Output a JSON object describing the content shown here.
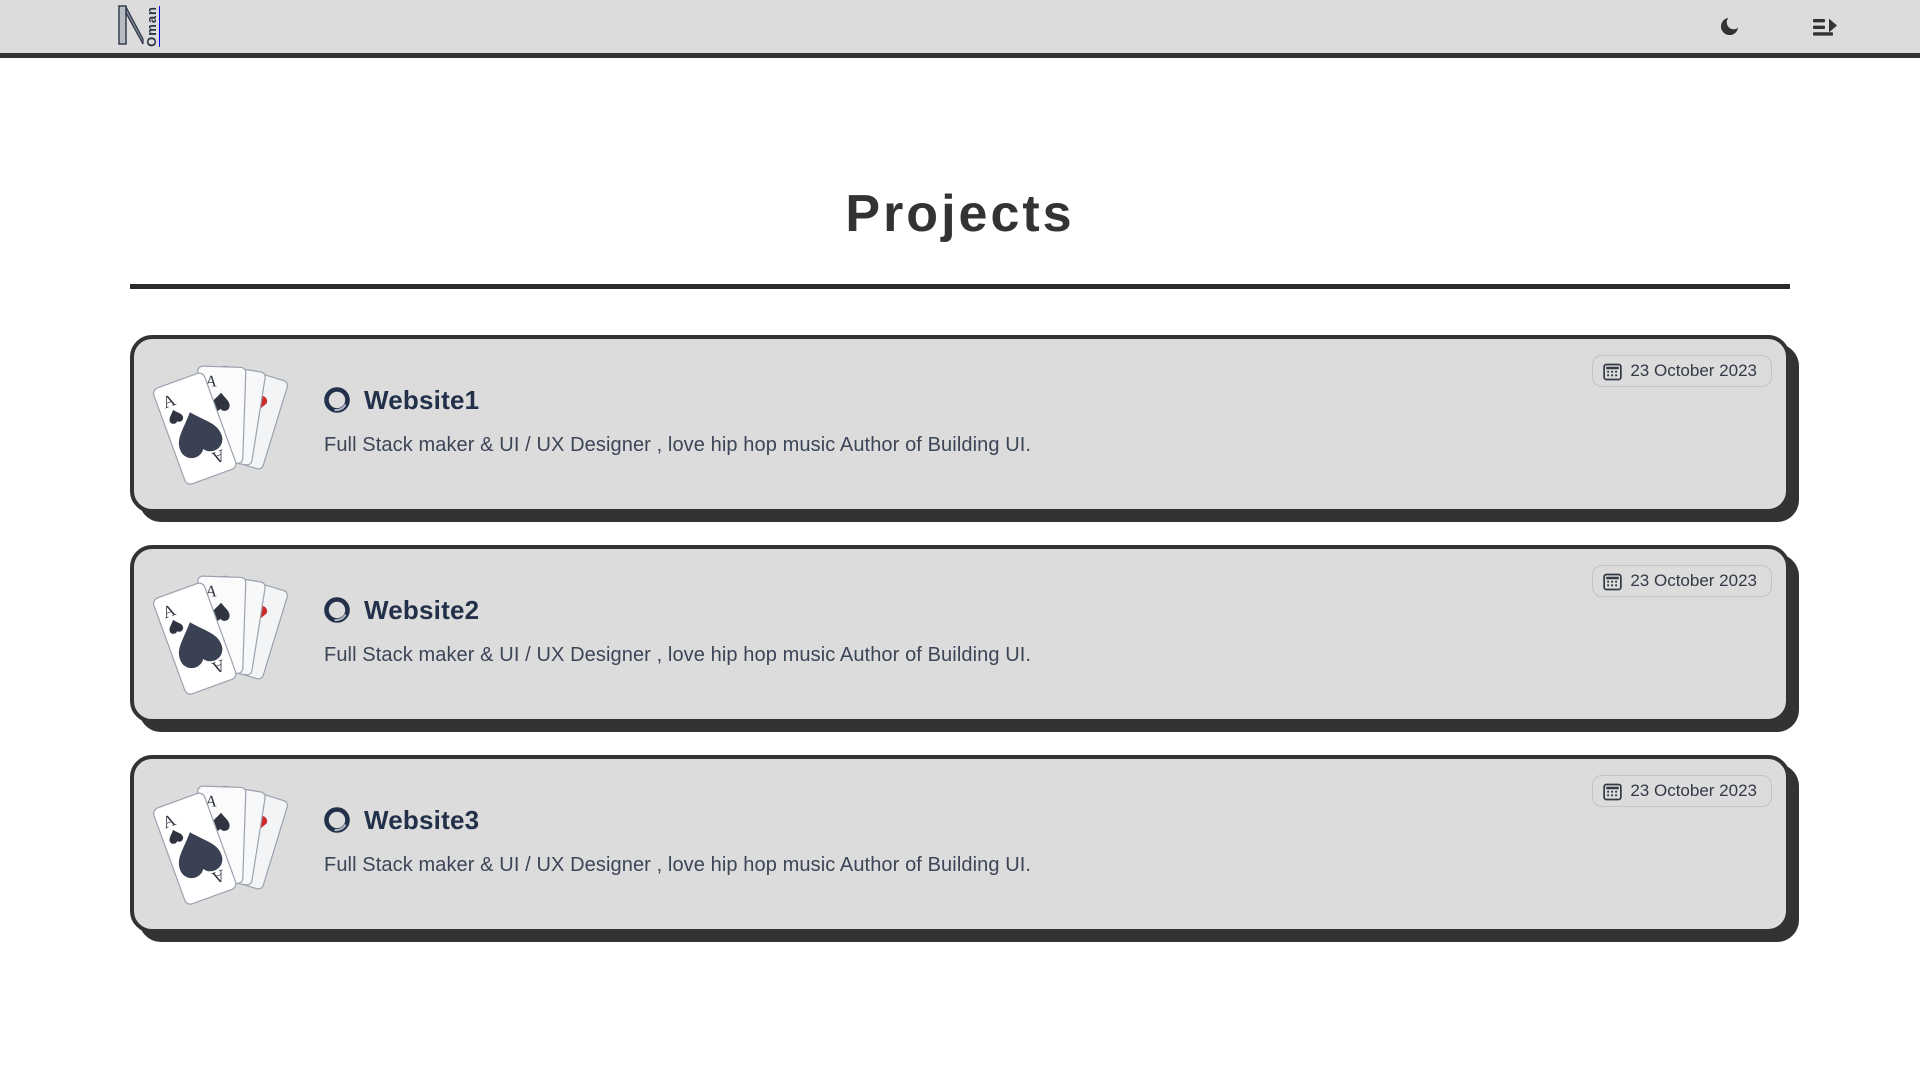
{
  "header": {
    "brand": {
      "mark": "N",
      "word": "Oman"
    },
    "actions": [
      {
        "name": "theme-toggle",
        "icon": "moon-icon",
        "label": "Dark mode"
      },
      {
        "name": "menu-toggle",
        "icon": "menu-arrow-icon",
        "label": "Menu"
      }
    ]
  },
  "main": {
    "title": "Projects",
    "projects": [
      {
        "title": "Website1",
        "description": "Full Stack maker & UI / UX Designer , love hip hop music Author of Building UI.",
        "date": "23 October 2023",
        "thumb_alt": "playing-cards"
      },
      {
        "title": "Website2",
        "description": "Full Stack maker & UI / UX Designer , love hip hop music Author of Building UI.",
        "date": "23 October 2023",
        "thumb_alt": "playing-cards"
      },
      {
        "title": "Website3",
        "description": "Full Stack maker & UI / UX Designer , love hip hop music Author of Building UI.",
        "date": "23 October 2023",
        "thumb_alt": "playing-cards"
      }
    ]
  },
  "colors": {
    "page_bg": "#ffffff",
    "surface": "#dcdcdc",
    "ink": "#333333",
    "title_ink": "#22304a",
    "body_ink": "#3b4557"
  }
}
